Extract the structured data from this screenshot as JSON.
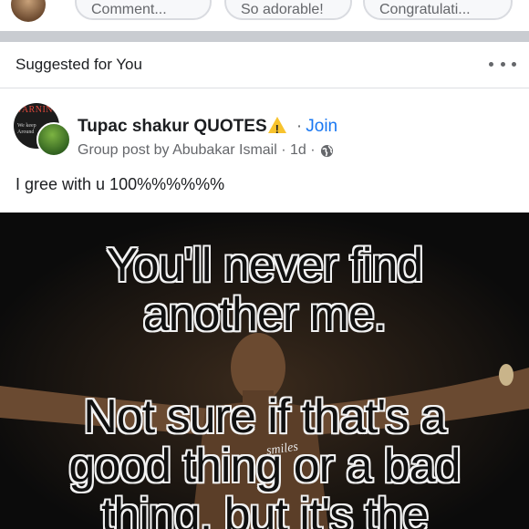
{
  "top_strip": {
    "pills": [
      "Comment...",
      "So adorable!",
      "Congratulati..."
    ]
  },
  "suggested": {
    "label": "Suggested for You"
  },
  "post": {
    "group_avatar_text": {
      "warning": "WARNING",
      "small": "We keep Around"
    },
    "group_name": "Tupac shakur QUOTES",
    "separator": "·",
    "join_label": "Join",
    "meta": "Group post by Abubakar Ismail · 1d ·",
    "text": "I gree with u 100%%%%%%",
    "image": {
      "quote_lines": [
        "You'll never find",
        "another me.",
        "Not sure if that's a",
        "good thing or a bad",
        "thing, but it's the"
      ],
      "watermark": "smiles"
    }
  },
  "icons": {
    "more": "more-options-icon",
    "warning": "warning-icon",
    "globe": "globe-icon"
  },
  "colors": {
    "link": "#1877f2",
    "secondary_text": "#65676b",
    "divider": "#c9ccd1"
  }
}
